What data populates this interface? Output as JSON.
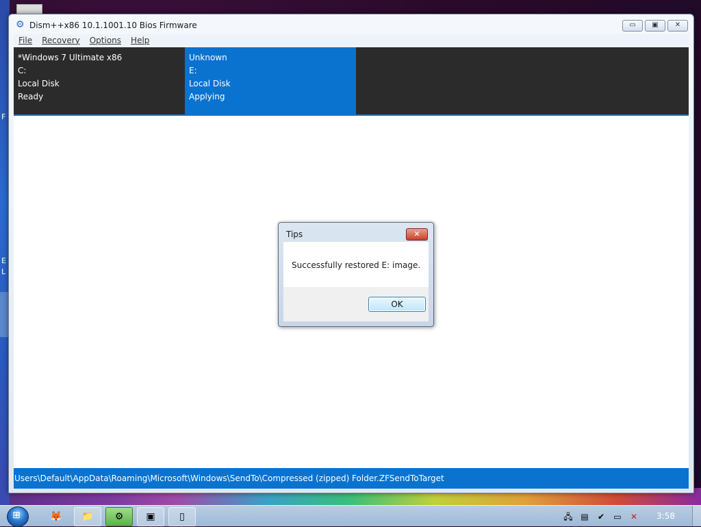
{
  "window": {
    "title": "Dism++x86 10.1.1001.10 Bios Firmware",
    "min_label": "▭",
    "max_label": "▣",
    "close_label": "✕"
  },
  "menu": {
    "items": [
      "File",
      "Recovery",
      "Options",
      "Help"
    ]
  },
  "images": [
    {
      "name": "*Windows 7 Ultimate x86",
      "drive": "C:",
      "type": "Local Disk",
      "status": "Ready"
    },
    {
      "name": "Unknown",
      "drive": "E:",
      "type": "Local Disk",
      "status": "Applying"
    }
  ],
  "status_path": "Users\\Default\\AppData\\Roaming\\Microsoft\\Windows\\SendTo\\Compressed (zipped) Folder.ZFSendToTarget",
  "dialog": {
    "title": "Tips",
    "message": "Successfully restored E: image.",
    "ok_label": "OK",
    "close_label": "✕"
  },
  "desktop_edge": {
    "text1": "F",
    "text2": "E",
    "text3": "L"
  },
  "taskbar": {
    "clock": "3:58",
    "buttons": [
      "firefox-icon",
      "file-explorer-icon",
      "dism-icon",
      "terminal-icon",
      "app-icon"
    ]
  },
  "colors": {
    "accent": "#0a73d0",
    "header_dark": "#2b2b2b"
  }
}
